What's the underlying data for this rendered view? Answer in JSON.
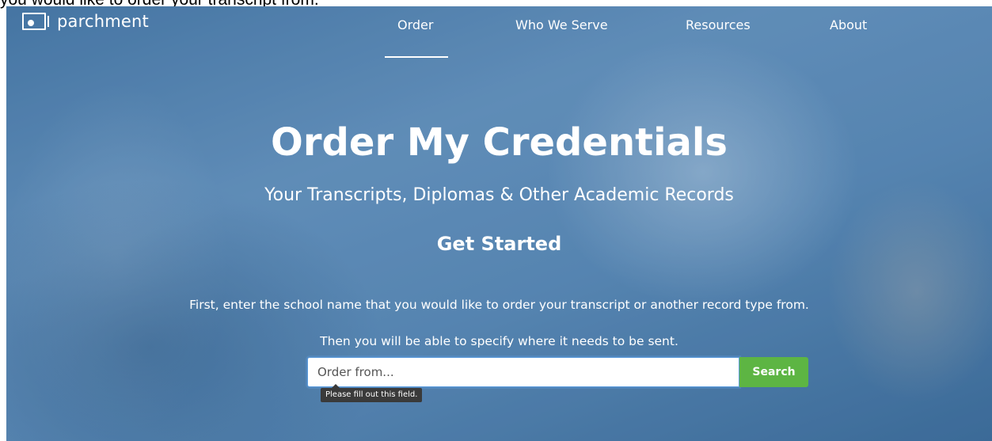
{
  "caption": "you would like to order your transcript from.",
  "brand": {
    "name": "parchment",
    "logo_icon": "parchment-logo-icon"
  },
  "nav": {
    "items": [
      {
        "label": "Order",
        "active": true
      },
      {
        "label": "Who We Serve",
        "active": false
      },
      {
        "label": "Resources",
        "active": false
      },
      {
        "label": "About",
        "active": false
      }
    ]
  },
  "hero": {
    "title": "Order My Credentials",
    "subtitle": "Your Transcripts, Diplomas & Other Academic Records",
    "get_started": "Get Started",
    "instruction_line1": "First, enter the school name that you would like to order your transcript or another record type from.",
    "instruction_line2": "Then you will be able to specify where it needs to be sent."
  },
  "search": {
    "placeholder": "Order from...",
    "value": "",
    "button_label": "Search",
    "validation_tooltip": "Please fill out this field."
  },
  "colors": {
    "accent_green": "#5db543",
    "input_focus": "#5b9bdd",
    "hero_overlay": "#4b7aa6"
  }
}
